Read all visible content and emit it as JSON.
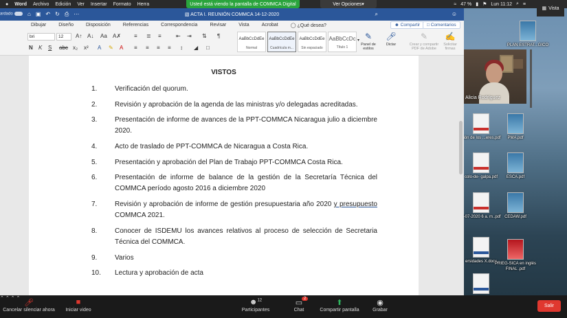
{
  "menubar": {
    "app_name": "Word",
    "menus": [
      "Archivo",
      "Edición",
      "Ver",
      "Insertar",
      "Formato",
      "Herra"
    ],
    "share_banner": "Usted está viendo la pantalla de COMMCA Digital",
    "view_options": "Ver Opciones",
    "battery": "47 %",
    "time": "Lun 11:12",
    "vista": "Vista"
  },
  "word": {
    "autosave_label": "ardado",
    "doc_title": "ACTA I. REUNIÓN COMMCA 14-12-2020",
    "tabs": [
      "Dibujar",
      "Diseño",
      "Disposición",
      "Referencias",
      "Correspondencia",
      "Revisar",
      "Vista",
      "Acrobat",
      "¿Qué desea?"
    ],
    "share_label": "Compartir",
    "comments_label": "Comentarios",
    "font_name": "bri",
    "font_size": "12",
    "styles": [
      {
        "sample": "AaBbCcDdEe",
        "name": "Normal"
      },
      {
        "sample": "AaBbCcDdEe",
        "name": "Cuadrícula m..."
      },
      {
        "sample": "AaBbCcDdEe",
        "name": "Sin espaciado"
      },
      {
        "sample": "AaBbCcDc",
        "name": "Título 1"
      }
    ],
    "panel_estilos": "Panel de estilos",
    "dictar": "Dictar",
    "crear_pdf": "Crear y compartir PDF de Adobe",
    "solicitar_firmas": "Solicitar firmas"
  },
  "document": {
    "heading": "VISTOS",
    "items": [
      {
        "num": "1.",
        "text": "Verificación del quorum."
      },
      {
        "num": "2.",
        "text": "Revisión y aprobación de la agenda de las ministras y/o delegadas acreditadas."
      },
      {
        "num": "3.",
        "text": "Presentación de informe de avances de la PPT-COMMCA Nicaragua julio a diciembre 2020."
      },
      {
        "num": "4.",
        "text": "Acto de traslado de PPT-COMMCA de Nicaragua a Costa Rica."
      },
      {
        "num": "5.",
        "text": "Presentación y aprobación del Plan de Trabajo PPT-COMMCA Costa Rica."
      },
      {
        "num": "6.",
        "text": "Presentación de informe de balance de la gestión de la Secretaría Técnica del COMMCA período agosto 2016 a diciembre 2020"
      },
      {
        "num": "7.",
        "text_a": "Revisión y aprobación de informe de gestión presupuestaria año 2020 ",
        "text_b": "y  presupuesto",
        "text_c": " COMMCA 2021."
      },
      {
        "num": "8.",
        "text": "Conocer de ISDEMU los avances relativos al proceso de selección de Secretaria Técnica del COMMCA."
      },
      {
        "num": "9.",
        "text": "Varios"
      },
      {
        "num": "10.",
        "text": "Lectura y aprobación de acta"
      }
    ]
  },
  "video": {
    "participant_name": "Alicia Rodríguez"
  },
  "desktop_files": [
    {
      "label": "PLAN ESTRAT...GICO",
      "kind": "cover"
    },
    {
      "label": "ción de los ...eres.pdf",
      "kind": "pdf"
    },
    {
      "label": "PMA.pdf",
      "kind": "cover"
    },
    {
      "label": "colo-de- galpa.pdf",
      "kind": "pdf"
    },
    {
      "label": "ESCA.pdf",
      "kind": "cover"
    },
    {
      "label": "2-07-2020 6 a. m..pdf",
      "kind": "pdf"
    },
    {
      "label": "CEDAW.pdf",
      "kind": "cover"
    },
    {
      "label": "ersidades X.docx",
      "kind": "docx"
    },
    {
      "label": "PRIEG-SICA en inglés FINAL .pdf",
      "kind": "red"
    },
    {
      "label": "docx",
      "kind": "docx"
    }
  ],
  "zoom": {
    "mute_label": "Cancelar silenciar ahora",
    "video_label": "Iniciar video",
    "participants_label": "Participantes",
    "participants_count": "12",
    "chat_label": "Chat",
    "chat_badge": "2",
    "share_label": "Compartir pantalla",
    "record_label": "Grabar",
    "leave_label": "Salir"
  }
}
